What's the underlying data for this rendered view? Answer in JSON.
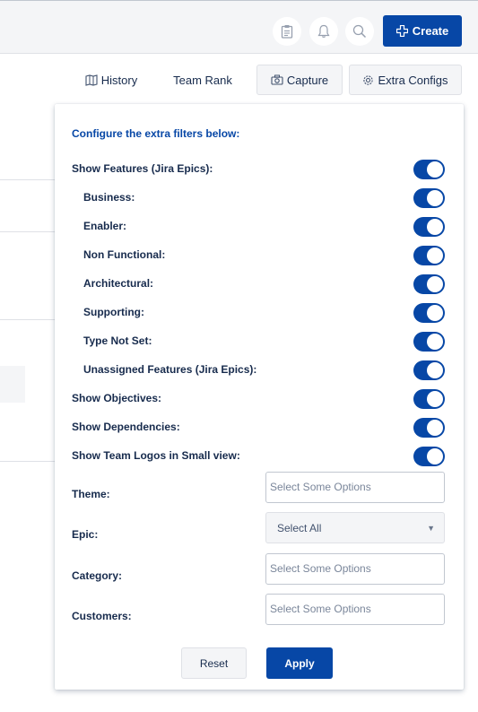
{
  "header": {
    "create_label": "Create",
    "icons": [
      "clipboard-icon",
      "bell-icon",
      "search-icon",
      "plus-icon"
    ]
  },
  "toolbar": {
    "history_label": "History",
    "team_rank_label": "Team Rank",
    "capture_label": "Capture",
    "extra_configs_label": "Extra Configs"
  },
  "panel": {
    "heading": "Configure the extra filters below:",
    "toggles": [
      {
        "label": "Show Features (Jira Epics):",
        "on": true
      },
      {
        "label": "Business:",
        "on": true
      },
      {
        "label": "Enabler:",
        "on": true
      },
      {
        "label": "Non Functional:",
        "on": true
      },
      {
        "label": "Architectural:",
        "on": true
      },
      {
        "label": "Supporting:",
        "on": true
      },
      {
        "label": "Type Not Set:",
        "on": true
      },
      {
        "label": "Unassigned Features (Jira Epics):",
        "on": true
      },
      {
        "label": "Show Objectives:",
        "on": true
      },
      {
        "label": "Show Dependencies:",
        "on": true
      },
      {
        "label": "Show Team Logos in Small view:",
        "on": true
      }
    ],
    "fields": {
      "theme": {
        "label": "Theme:",
        "placeholder": "Select Some Options"
      },
      "epic": {
        "label": "Epic:",
        "value": "Select All"
      },
      "category": {
        "label": "Category:",
        "placeholder": "Select Some Options"
      },
      "customers": {
        "label": "Customers:",
        "placeholder": "Select Some Options"
      }
    },
    "reset_label": "Reset",
    "apply_label": "Apply"
  },
  "colors": {
    "primary": "#0747a6",
    "heading": "#0747a6",
    "text": "#172b4d",
    "muted": "#7a869a",
    "surface": "#f4f5f7"
  }
}
